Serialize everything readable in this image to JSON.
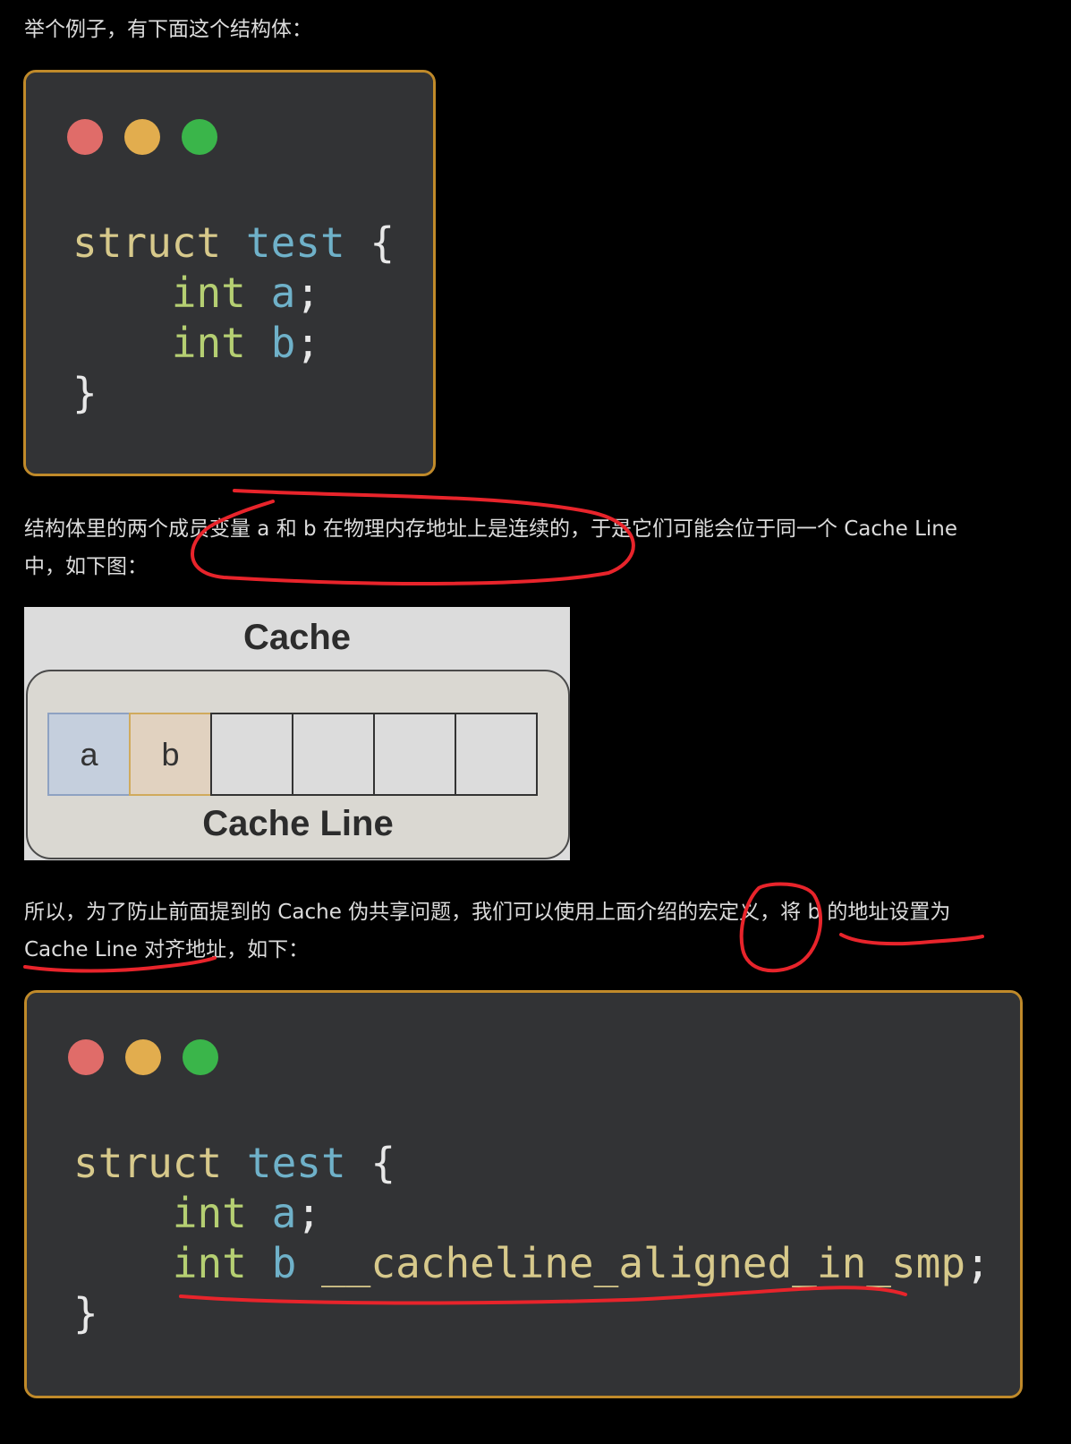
{
  "intro_text": "举个例子，有下面这个结构体：",
  "code1": {
    "lines": [
      {
        "kw": "struct",
        "name": "test",
        "brace": "{"
      },
      {
        "type": "int",
        "var": "a",
        "semi": ";"
      },
      {
        "type": "int",
        "var": "b",
        "semi": ";"
      },
      {
        "close": "}"
      }
    ]
  },
  "para2": {
    "line1": "结构体里的两个成员变量 a 和 b 在物理内存地址上是连续的，于是它们可能会位于同一个 Cache Line",
    "line2": "中，如下图："
  },
  "cache_diagram": {
    "title": "Cache",
    "cells": [
      "a",
      "b",
      "",
      "",
      "",
      ""
    ],
    "line_label": "Cache Line"
  },
  "para3": {
    "line1": "所以，为了防止前面提到的 Cache 伪共享问题，我们可以使用上面介绍的宏定义，将 b 的地址设置为",
    "line2": "Cache Line 对齐地址，如下："
  },
  "code2": {
    "lines": [
      {
        "kw": "struct",
        "name": "test",
        "brace": "{"
      },
      {
        "type": "int",
        "var": "a",
        "semi": ";"
      },
      {
        "type": "int",
        "var": "b",
        "macro": "__cacheline_aligned_in_smp",
        "semi": ";"
      },
      {
        "close": "}"
      }
    ]
  },
  "colors": {
    "annotation": "#e8242b",
    "code_bg": "#323335",
    "border": "#c08a2a"
  }
}
